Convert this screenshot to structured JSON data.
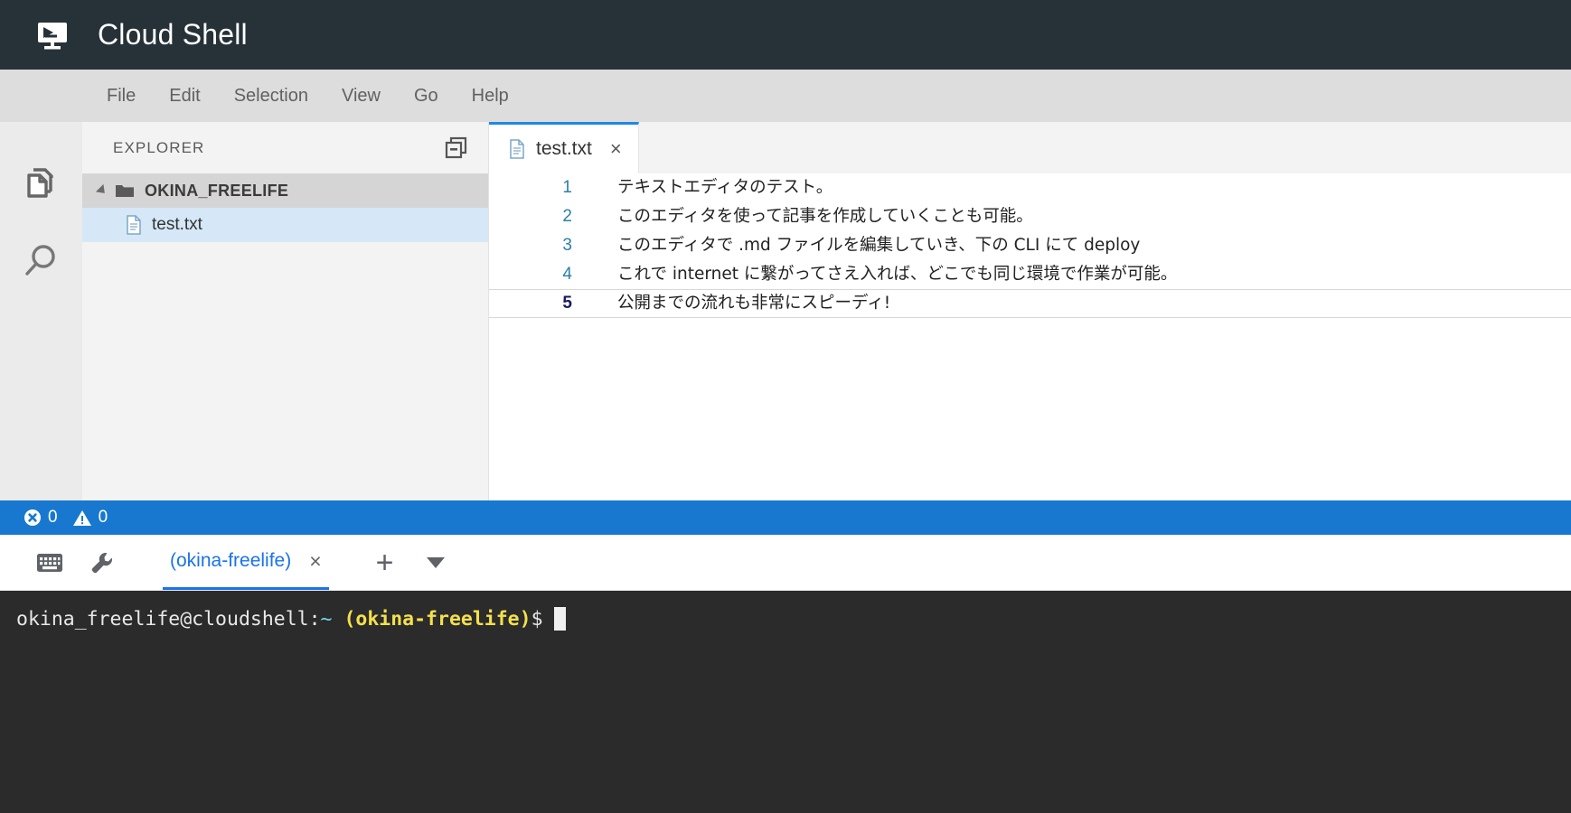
{
  "header": {
    "title": "Cloud Shell",
    "logo_icon": "cloud-shell-terminal-icon",
    "background": "#263238"
  },
  "menubar": {
    "items": [
      {
        "label": "File"
      },
      {
        "label": "Edit"
      },
      {
        "label": "Selection"
      },
      {
        "label": "View"
      },
      {
        "label": "Go"
      },
      {
        "label": "Help"
      }
    ]
  },
  "activitybar": {
    "items": [
      {
        "icon": "files-explorer-icon",
        "name": "explorer"
      },
      {
        "icon": "search-icon",
        "name": "search"
      }
    ]
  },
  "sidebar": {
    "title": "EXPLORER",
    "action_icon": "split-editor-icon",
    "tree": {
      "folder": {
        "label": "OKINA_FREELIFE",
        "expanded": true,
        "icon": "folder-icon"
      },
      "files": [
        {
          "label": "test.txt",
          "icon": "text-file-icon",
          "selected": true
        }
      ]
    }
  },
  "editor": {
    "tabs": [
      {
        "label": "test.txt",
        "icon": "text-file-icon",
        "close": "×",
        "active": true
      }
    ],
    "lines": [
      {
        "num": "1",
        "text": "テキストエディタのテスト。",
        "current": false
      },
      {
        "num": "2",
        "text": "このエディタを使って記事を作成していくことも可能。",
        "current": false
      },
      {
        "num": "3",
        "text": "このエディタで .md ファイルを編集していき、下の CLI にて deploy",
        "current": false
      },
      {
        "num": "4",
        "text": "これで internet に繋がってさえ入れば、どこでも同じ環境で作業が可能。",
        "current": false
      },
      {
        "num": "5",
        "text": "公開までの流れも非常にスピーディ!",
        "current": true
      }
    ]
  },
  "statusbar": {
    "background": "#1878cf",
    "errors": {
      "icon": "error-circle-icon",
      "count": "0"
    },
    "warnings": {
      "icon": "warning-triangle-icon",
      "count": "0"
    }
  },
  "terminal": {
    "toolbar": [
      {
        "icon": "keyboard-icon",
        "name": "keyboard"
      },
      {
        "icon": "wrench-icon",
        "name": "settings"
      }
    ],
    "tabs": [
      {
        "label": "(okina-freelife)",
        "close": "×",
        "active": true
      }
    ],
    "add_label": "+",
    "dropdown_icon": "chevron-down-icon",
    "prompt": {
      "user_host": "okina_freelife@cloudshell:",
      "path": "~",
      "project": "(okina-freelife)",
      "symbol": "$"
    },
    "background": "#2b2b2b"
  }
}
